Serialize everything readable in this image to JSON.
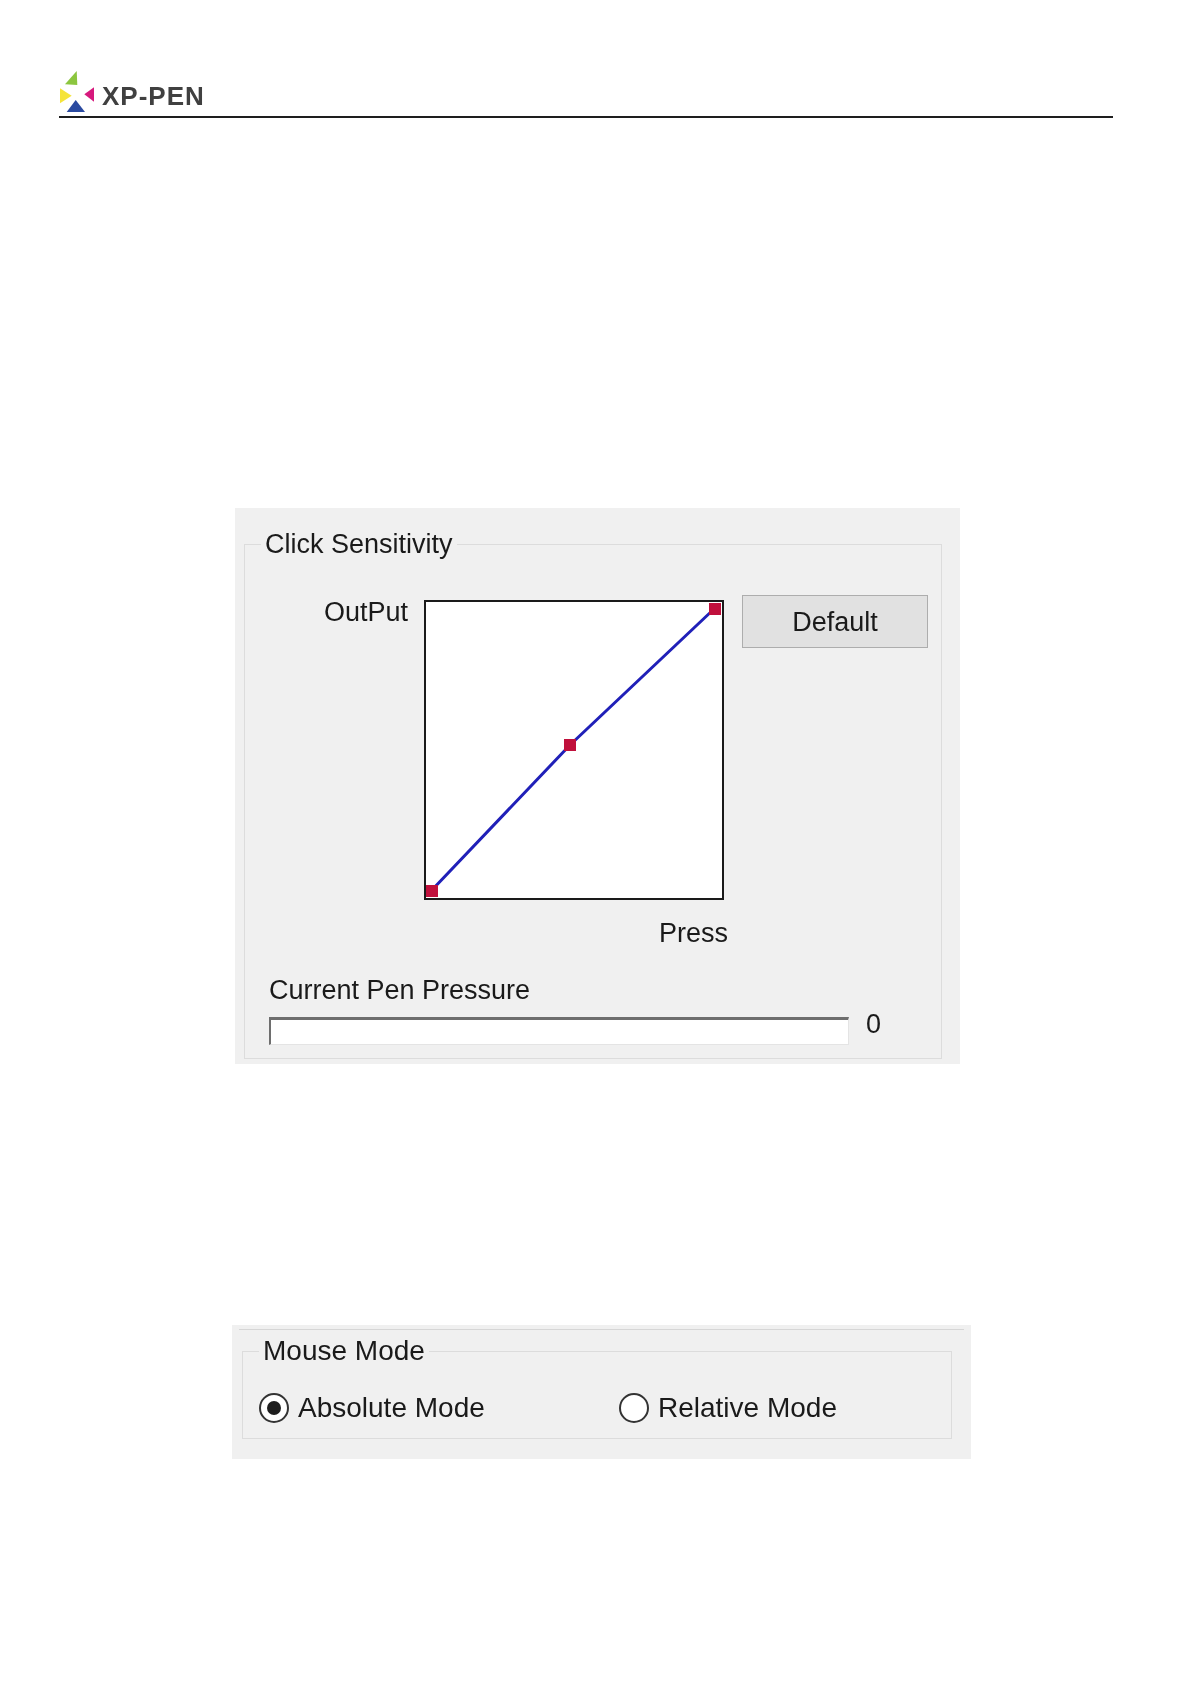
{
  "header": {
    "logo_text": "XP-PEN"
  },
  "click_sensitivity": {
    "title": "Click Sensitivity",
    "output_label": "OutPut",
    "press_label": "Press",
    "default_button": "Default",
    "pressure_label": "Current Pen Pressure",
    "pressure_reading": "0"
  },
  "mouse_mode": {
    "title": "Mouse Mode",
    "options": [
      {
        "label": "Absolute Mode",
        "selected": true
      },
      {
        "label": "Relative Mode",
        "selected": false
      }
    ]
  }
}
